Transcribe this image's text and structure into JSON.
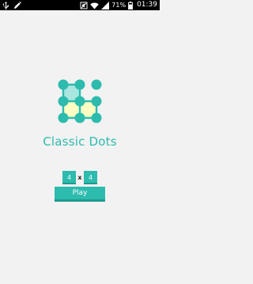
{
  "status_bar": {
    "battery_percent": "71%",
    "time": "01:39",
    "left_icons": [
      "usb-icon",
      "pencil-icon"
    ],
    "right_icons": [
      "sound-muted-icon",
      "wifi-icon",
      "signal-icon",
      "battery-icon"
    ]
  },
  "app": {
    "title": "Classic Dots",
    "grid_cols": "4",
    "grid_separator": "x",
    "grid_rows": "4",
    "play_label": "Play"
  },
  "colors": {
    "accent": "#2dbbae",
    "accent_dark": "#1e9a8f",
    "light_fill": "#ffffc4",
    "faded_fill": "#a8e6df",
    "background": "#f2f2f2",
    "status_bar": "#000000"
  }
}
